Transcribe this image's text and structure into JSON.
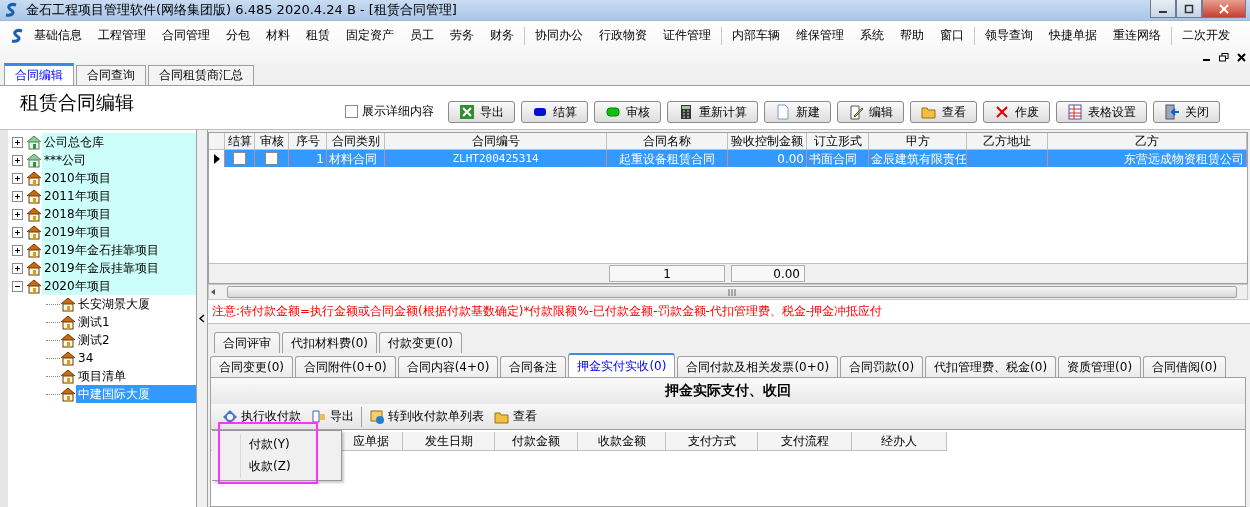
{
  "window": {
    "title": "金石工程项目管理软件(网络集团版) 6.485  2020.4.24 B - [租赁合同管理]"
  },
  "menu_groups": [
    [
      "基础信息",
      "工程管理",
      "合同管理",
      "分包",
      "材料",
      "租赁",
      "固定资产",
      "员工",
      "劳务",
      "财务"
    ],
    [
      "协同办公",
      "行政物资",
      "证件管理"
    ],
    [
      "内部车辆",
      "维保管理",
      "系统",
      "帮助",
      "窗口"
    ],
    [
      "领导查询",
      "快捷单据",
      "重连网络"
    ],
    [
      "二次开发"
    ]
  ],
  "doc_tabs": [
    {
      "label": "合同编辑",
      "selected": true
    },
    {
      "label": "合同查询",
      "selected": false
    },
    {
      "label": "合同租赁商汇总",
      "selected": false
    }
  ],
  "page_title": "租赁合同编辑",
  "show_details": {
    "label": "展示详细内容",
    "checked": false
  },
  "toolbar": [
    {
      "label": "导出",
      "kind": "excel"
    },
    {
      "label": "结算",
      "kind": "blue"
    },
    {
      "label": "审核",
      "kind": "green"
    },
    {
      "label": "重新计算",
      "kind": "calc"
    },
    {
      "label": "新建",
      "kind": "new"
    },
    {
      "label": "编辑",
      "kind": "edit"
    },
    {
      "label": "查看",
      "kind": "view"
    },
    {
      "label": "作废",
      "kind": "void"
    },
    {
      "label": "表格设置",
      "kind": "grid"
    },
    {
      "label": "关闭",
      "kind": "close"
    }
  ],
  "tree": [
    {
      "label": "公司总仓库",
      "kind": "warehouse",
      "expanded": false,
      "selected": false
    },
    {
      "label": "***公司",
      "kind": "warehouse",
      "expanded": false,
      "selected": false
    },
    {
      "label": "2010年项目",
      "kind": "project",
      "expanded": false,
      "selected": false
    },
    {
      "label": "2011年项目",
      "kind": "project",
      "expanded": false,
      "selected": false
    },
    {
      "label": "2018年项目",
      "kind": "project",
      "expanded": false,
      "selected": false
    },
    {
      "label": "2019年项目",
      "kind": "project",
      "expanded": false,
      "selected": false
    },
    {
      "label": "2019年金石挂靠项目",
      "kind": "project",
      "expanded": false,
      "selected": false
    },
    {
      "label": "2019年金辰挂靠项目",
      "kind": "project",
      "expanded": false,
      "selected": false
    },
    {
      "label": "2020年项目",
      "kind": "project",
      "expanded": true,
      "selected": false,
      "children": [
        {
          "label": "长安湖景大厦",
          "kind": "project",
          "selected": false
        },
        {
          "label": "测试1",
          "kind": "project",
          "selected": false
        },
        {
          "label": "测试2",
          "kind": "project",
          "selected": false
        },
        {
          "label": "34",
          "kind": "project",
          "selected": false
        },
        {
          "label": "项目清单",
          "kind": "project",
          "selected": false
        },
        {
          "label": "中建国际大厦",
          "kind": "project",
          "selected": true
        }
      ]
    }
  ],
  "contracts": {
    "check_columns": [
      "结算",
      "审核"
    ],
    "columns": [
      "序号",
      "合同类别",
      "合同编号",
      "合同名称",
      "验收控制金额",
      "订立形式",
      "甲方",
      "乙方地址",
      "乙方"
    ],
    "rows": [
      {
        "selected": true,
        "settled": false,
        "audited": false,
        "cells": [
          "1",
          "材料合同",
          "ZLHT200425314",
          "起重设备租赁合同",
          "0.00",
          "书面合同",
          "金辰建筑有限责任",
          "",
          "东营远成物资租赁公司"
        ]
      }
    ],
    "footer": [
      "1",
      "0.00"
    ]
  },
  "notice": "注意:待付款金额=执行金额或合同金额(根据付款基数确定)*付款限额%-已付款金额-罚款金额-代扣管理费、税金-押金冲抵应付",
  "detail_tabs_row1": [
    {
      "label": "合同评审",
      "selected": false
    },
    {
      "label": "代扣材料费(0)",
      "selected": false
    },
    {
      "label": "付款变更(0)",
      "selected": false
    }
  ],
  "detail_tabs_row2": [
    {
      "label": "合同变更(0)",
      "selected": false
    },
    {
      "label": "合同附件(0+0)",
      "selected": false
    },
    {
      "label": "合同内容(4+0)",
      "selected": false
    },
    {
      "label": "合同备注",
      "selected": false
    },
    {
      "label": "押金实付实收(0)",
      "selected": true
    },
    {
      "label": "合同付款及相关发票(0+0)",
      "selected": false
    },
    {
      "label": "合同罚款(0)",
      "selected": false
    },
    {
      "label": "代扣管理费、税金(0)",
      "selected": false
    },
    {
      "label": "资质管理(0)",
      "selected": false
    },
    {
      "label": "合同借阅(0)",
      "selected": false
    }
  ],
  "panel_title": "押金实际支付、收回",
  "panel_toolbar": [
    {
      "label": "执行收付款",
      "kind": "execute"
    },
    {
      "label": "导出",
      "kind": "export"
    },
    {
      "label": "转到收付款单列表",
      "kind": "transfer"
    },
    {
      "label": "查看",
      "kind": "view"
    }
  ],
  "payments": {
    "columns": [
      "应单据",
      "发生日期",
      "付款金额",
      "收款金额",
      "支付方式",
      "支付流程",
      "经办人"
    ]
  },
  "popup_menu": [
    "付款(Y)",
    "收款(Z)"
  ]
}
